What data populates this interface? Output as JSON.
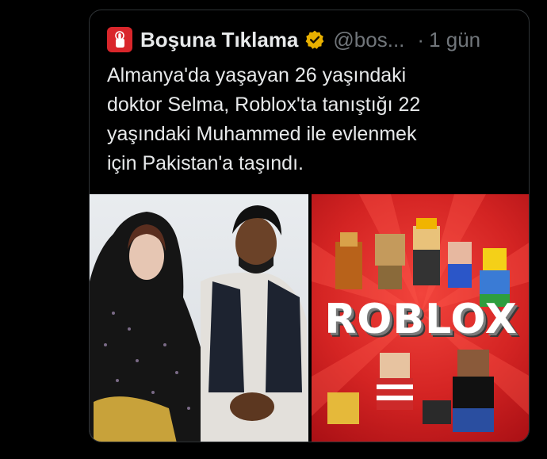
{
  "tweet": {
    "author": {
      "name": "Boşuna Tıklama",
      "handle": "@bos...",
      "avatar_icon": "pointing-hand-icon",
      "avatar_color": "#d9262b",
      "verified_badge_icon": "gold-verified-badge-icon",
      "verified_color": "#e8b000"
    },
    "separator": "·",
    "time": "1 gün",
    "text_lines": [
      "Almanya'da yaşayan 26 yaşındaki",
      "doktor Selma, Roblox'ta tanıştığı 22",
      "yaşındaki Muhammed ile evlenmek",
      "için Pakistan'a taşındı."
    ],
    "media": {
      "left_image_description_icon": "couple-photo",
      "right_image_logo_text": "ROBLOX"
    }
  },
  "colors": {
    "background": "#000000",
    "text_primary": "#e7e9ea",
    "text_secondary": "#71767b",
    "border": "#2f3336",
    "roblox_red": "#d42423"
  }
}
